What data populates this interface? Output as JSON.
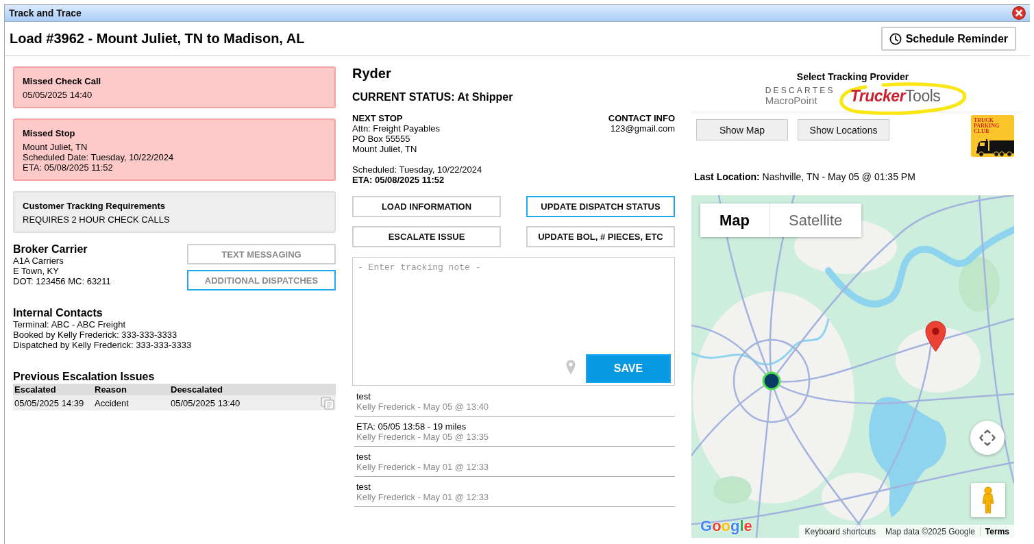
{
  "window": {
    "title": "Track and Trace"
  },
  "header": {
    "title": "Load #3962 - Mount Juliet, TN to Madison, AL",
    "reminder_button": "Schedule Reminder"
  },
  "alerts": [
    {
      "kind": "missed",
      "title": "Missed Check Call",
      "lines": [
        "05/05/2025 14:40"
      ]
    },
    {
      "kind": "missed",
      "title": "Missed Stop",
      "lines": [
        "Mount Juliet, TN",
        "Scheduled Date: Tuesday, 10/22/2024",
        "ETA: 05/08/2025 11:52"
      ]
    },
    {
      "kind": "info",
      "title": "Customer Tracking Requirements",
      "lines": [
        "REQUIRES 2 HOUR CHECK CALLS"
      ]
    }
  ],
  "broker_carrier": {
    "heading": "Broker Carrier",
    "lines": [
      "A1A Carriers",
      "E Town, KY",
      "DOT: 123456 MC: 63211"
    ]
  },
  "side_buttons": [
    {
      "label": "TEXT MESSAGING",
      "highlighted": false
    },
    {
      "label": "ADDITIONAL DISPATCHES",
      "highlighted": true
    }
  ],
  "internal_contacts": {
    "heading": "Internal Contacts",
    "lines": [
      "Terminal: ABC - ABC Freight",
      "Booked by Kelly Frederick: 333-333-3333",
      "Dispatched by Kelly Frederick: 333-333-3333"
    ]
  },
  "escalations": {
    "heading": "Previous Escalation Issues",
    "columns": [
      "Escalated",
      "Reason",
      "Deescalated"
    ],
    "rows": [
      [
        "05/05/2025 14:39",
        "Accident",
        "05/05/2025 13:40"
      ]
    ]
  },
  "carrier": {
    "name": "Ryder",
    "status": "CURRENT STATUS: At Shipper"
  },
  "next_stop": {
    "heading": "NEXT STOP",
    "lines": [
      "Attn: Freight Payables",
      "PO Box 55555",
      "Mount Juliet, TN"
    ],
    "scheduled": "Scheduled: Tuesday, 10/22/2024",
    "eta": "ETA: 05/08/2025 11:52"
  },
  "contact": {
    "heading": "CONTACT INFO",
    "lines": [
      "123@gmail.com"
    ]
  },
  "action_buttons": [
    {
      "label": "LOAD INFORMATION",
      "highlighted": false
    },
    {
      "label": "UPDATE DISPATCH STATUS",
      "highlighted": true
    },
    {
      "label": "ESCALATE ISSUE",
      "highlighted": false
    },
    {
      "label": "UPDATE BOL, # PIECES, ETC",
      "highlighted": false
    }
  ],
  "note": {
    "placeholder": "- Enter tracking note -",
    "save_button": "SAVE"
  },
  "notes": [
    {
      "text": "test",
      "meta": "Kelly Frederick - May 05 @ 13:40"
    },
    {
      "text": "ETA: 05/05 13:58 - 19 miles",
      "meta": "Kelly Frederick - May 05 @ 13:35"
    },
    {
      "text": "test",
      "meta": "Kelly Frederick - May 01 @ 12:33"
    },
    {
      "text": "test",
      "meta": "Kelly Frederick - May 01 @ 12:33"
    }
  ],
  "tracking": {
    "heading": "Select Tracking Provider",
    "providers": [
      {
        "kind": "descartes",
        "lines": [
          "DESCARTES",
          "MacroPoint"
        ],
        "selected": false
      },
      {
        "kind": "truckertools",
        "lines": [
          "Trucker",
          "Tools"
        ],
        "selected": true
      }
    ],
    "buttons": [
      "Show Map",
      "Show Locations"
    ],
    "badge": {
      "lines": [
        "TRUCK",
        "PARKING",
        "CLUB"
      ]
    }
  },
  "last_location": {
    "label": "Last Location:",
    "value": "Nashville, TN - May 05 @ 01:35 PM"
  },
  "map": {
    "tabs": [
      {
        "label": "Map",
        "selected": true
      },
      {
        "label": "Satellite",
        "selected": false
      }
    ],
    "logo": "Google",
    "attribution": [
      {
        "kind": "link",
        "label": "Keyboard shortcuts"
      },
      {
        "kind": "notice",
        "label": "Map data ©2025 Google"
      },
      {
        "kind": "terms",
        "label": "Terms"
      }
    ]
  }
}
